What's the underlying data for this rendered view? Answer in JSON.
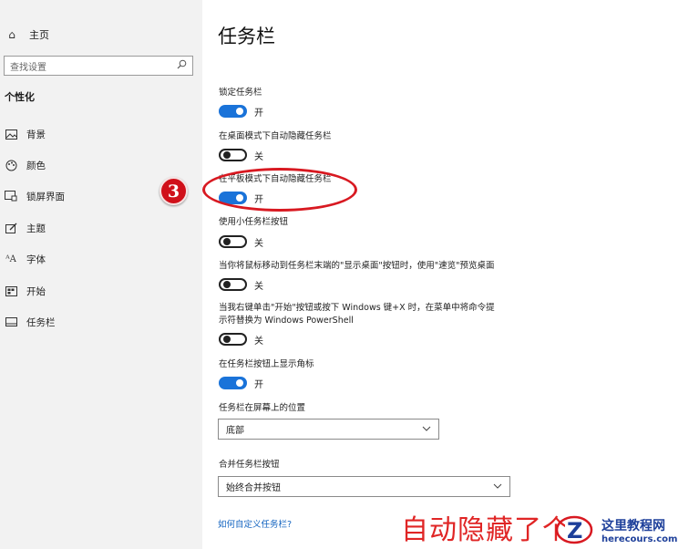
{
  "sidebar": {
    "home_label": "主页",
    "search_placeholder": "查找设置",
    "section_title": "个性化",
    "items": [
      {
        "label": "背景",
        "icon": "picture-icon"
      },
      {
        "label": "颜色",
        "icon": "palette-icon"
      },
      {
        "label": "锁屏界面",
        "icon": "lock-screen-icon"
      },
      {
        "label": "主题",
        "icon": "brush-icon"
      },
      {
        "label": "字体",
        "icon": "font-icon"
      },
      {
        "label": "开始",
        "icon": "start-icon"
      },
      {
        "label": "任务栏",
        "icon": "taskbar-icon"
      }
    ]
  },
  "main": {
    "title": "任务栏",
    "settings": [
      {
        "label": "锁定任务栏",
        "state": "开",
        "on": true
      },
      {
        "label": "在桌面模式下自动隐藏任务栏",
        "state": "关",
        "on": false
      },
      {
        "label": "在平板模式下自动隐藏任务栏",
        "state": "开",
        "on": true
      },
      {
        "label": "使用小任务栏按钮",
        "state": "关",
        "on": false
      },
      {
        "label": "当你将鼠标移动到任务栏末端的\"显示桌面\"按钮时，使用\"速览\"预览桌面",
        "state": "关",
        "on": false
      },
      {
        "label_line1": "当我右键单击\"开始\"按钮或按下 Windows 键+X 时，在菜单中将命令提",
        "label_line2": "示符替换为 Windows PowerShell",
        "state": "关",
        "on": false
      },
      {
        "label": "在任务栏按钮上显示角标",
        "state": "开",
        "on": true
      }
    ],
    "position": {
      "label": "任务栏在屏幕上的位置",
      "value": "底部"
    },
    "combine": {
      "label": "合并任务栏按钮",
      "value": "始终合并按钮"
    },
    "help_link": "如何自定义任务栏?"
  },
  "overlay": {
    "step_number": "3",
    "caption": "自动隐藏了个",
    "watermark_title": "这里教程网",
    "watermark_url": "herecours.com"
  },
  "colors": {
    "toggle_on": "#1a73d9",
    "accent_red": "#d81921",
    "link": "#1565c0"
  }
}
